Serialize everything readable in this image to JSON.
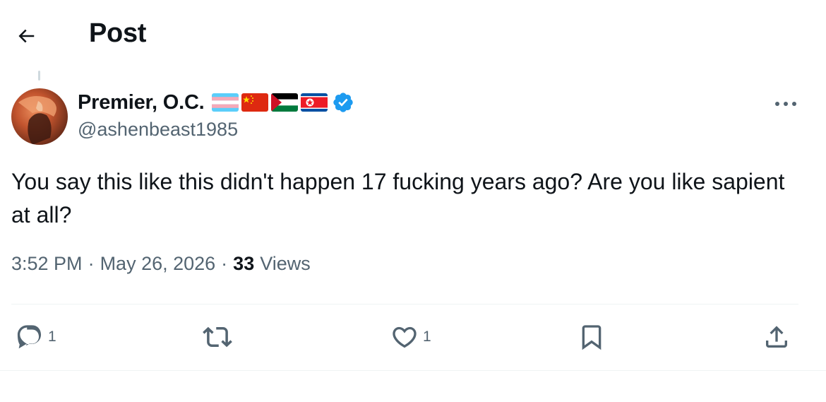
{
  "header": {
    "title": "Post"
  },
  "tweet": {
    "author": {
      "display_name": "Premier, O.C.",
      "handle": "@ashenbeast1985",
      "flags": [
        "transgender-flag",
        "china-flag",
        "palestine-flag",
        "north-korea-flag"
      ],
      "verified_color": "#1d9bf0"
    },
    "text": "You say this like this didn't happen 17 fucking years ago? Are you like sapient at all?",
    "time": "3:52 PM",
    "separator": "·",
    "date": "May 26, 2026",
    "views_count": "33",
    "views_label": "Views"
  },
  "actions": {
    "reply_count": "1",
    "retweet_count": "",
    "like_count": "1"
  },
  "colors": {
    "text_primary": "#0f1419",
    "text_secondary": "#536471",
    "divider": "#eff3f4",
    "accent": "#1d9bf0"
  }
}
